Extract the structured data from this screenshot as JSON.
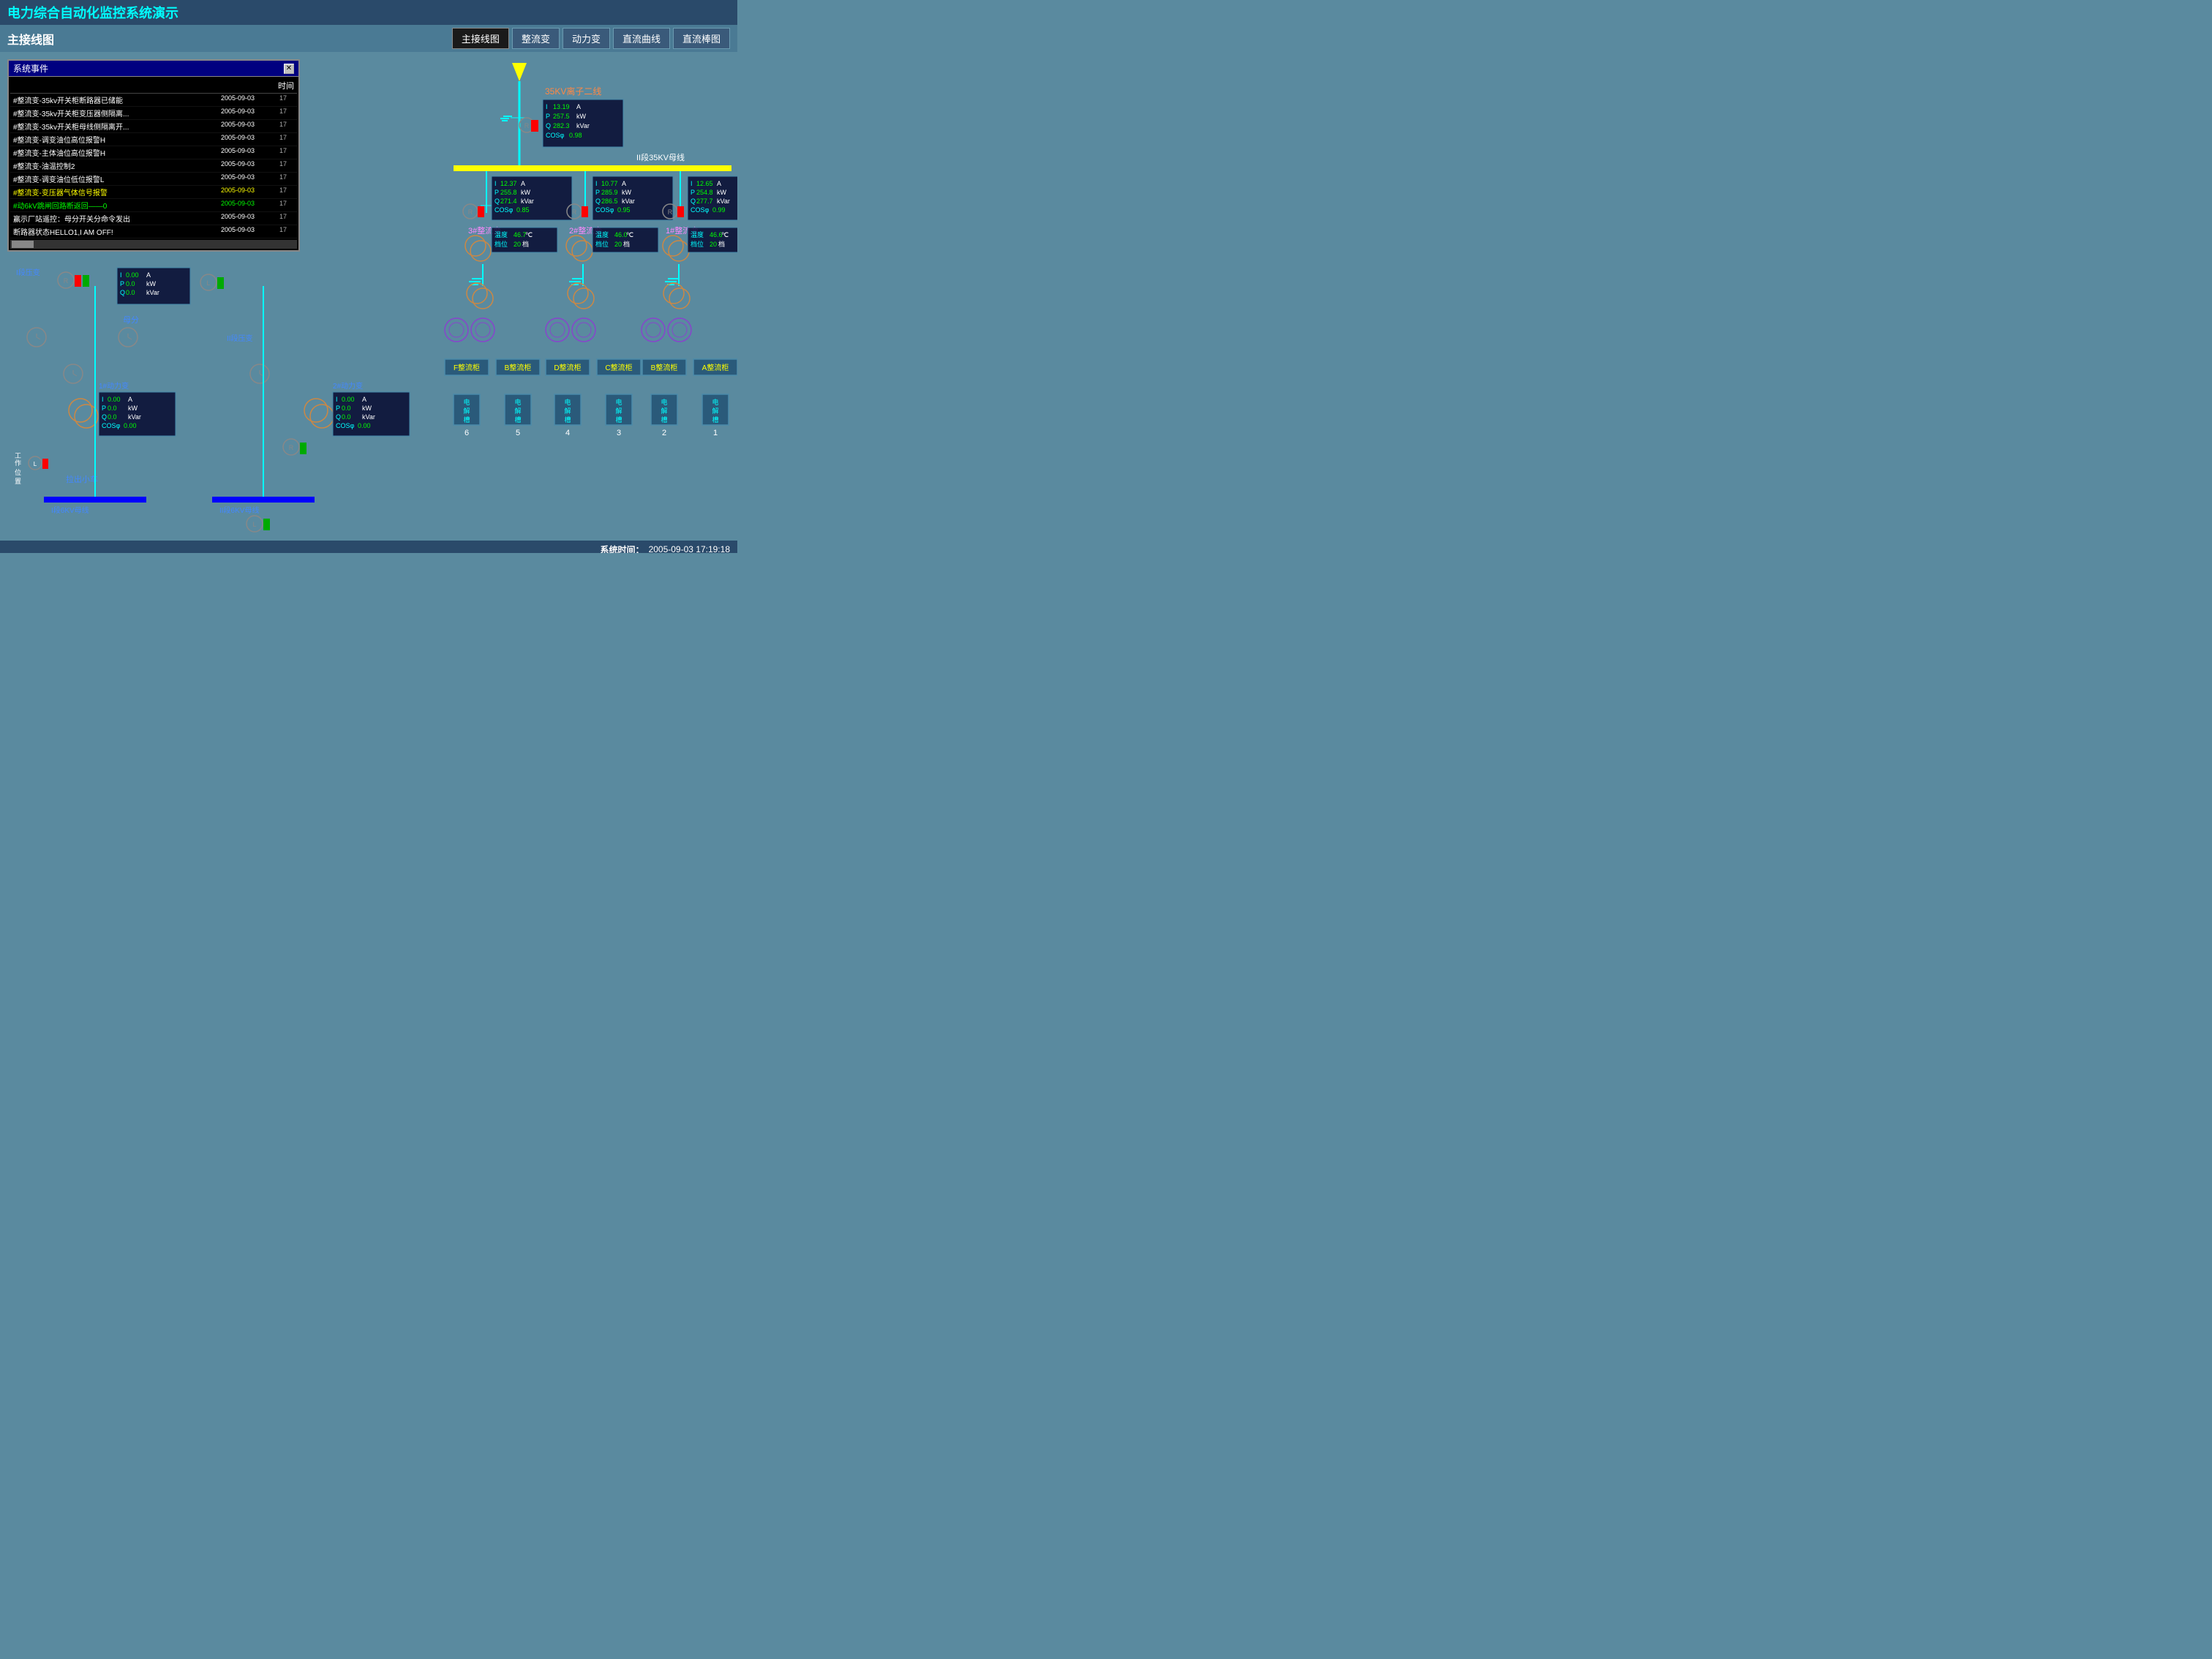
{
  "title": "电力综合自动化监控系统演示",
  "subtitle": "主接线图",
  "nav": {
    "buttons": [
      {
        "label": "主接线图",
        "active": true
      },
      {
        "label": "整流变",
        "active": false
      },
      {
        "label": "动力变",
        "active": false
      },
      {
        "label": "直流曲线",
        "active": false
      },
      {
        "label": "直流棒图",
        "active": false
      }
    ]
  },
  "dialog": {
    "title": "系统事件",
    "time_header": "时间",
    "events": [
      {
        "msg": "#整流变-35kv开关柜断路器已储能",
        "date": "2005-09-03",
        "time": "17",
        "color": "white"
      },
      {
        "msg": "#整流变-35kv开关柜变压器侧隔离...",
        "date": "2005-09-03",
        "time": "17",
        "color": "white"
      },
      {
        "msg": "#整流变-35kv开关柜母线侧隔离开...",
        "date": "2005-09-03",
        "time": "17",
        "color": "white"
      },
      {
        "msg": "#整流变-调变油位高位报警H",
        "date": "2005-09-03",
        "time": "17",
        "color": "white"
      },
      {
        "msg": "#整流变-主体油位高位报警H",
        "date": "2005-09-03",
        "time": "17",
        "color": "white"
      },
      {
        "msg": "#整流变-油温控制2",
        "date": "2005-09-03",
        "time": "17",
        "color": "white"
      },
      {
        "msg": "#整流变-调变油位低位报警L",
        "date": "2005-09-03",
        "time": "17",
        "color": "white"
      },
      {
        "msg": "#整流变-变压器气体信号报警",
        "date": "2005-09-03",
        "time": "17",
        "color": "yellow"
      },
      {
        "msg": "#动6kV跳闸回路断返回——0",
        "date": "2005-09-03",
        "time": "17",
        "color": "green"
      },
      {
        "msg": "赢示厂站遥控：母分开关分命令发出",
        "date": "2005-09-03",
        "time": "17",
        "color": "white"
      },
      {
        "msg": "断路器状态HELLO1,I AM OFF!",
        "date": "2005-09-03",
        "time": "17",
        "color": "white"
      }
    ]
  },
  "section_35kv": {
    "title": "35KV离子二线",
    "busbar_label": "II段35KV母线",
    "measurements": {
      "I": "13.19",
      "I_unit": "A",
      "P": "257.5",
      "P_unit": "kW",
      "Q": "282.3",
      "Q_unit": "kVar",
      "COS": "0.98"
    }
  },
  "rectifiers": [
    {
      "name": "3#整流变",
      "I": "12.37",
      "I_unit": "A",
      "P": "255.8",
      "P_unit": "kW",
      "Q": "271.4",
      "Q_unit": "kVar",
      "COS": "0.85",
      "temp": "46.7",
      "temp_unit": "℃",
      "档位": "20",
      "档": "档"
    },
    {
      "name": "2#整流变",
      "I": "10.77",
      "I_unit": "A",
      "P": "285.9",
      "P_unit": "kW",
      "Q": "286.5",
      "Q_unit": "kVar",
      "COS": "0.95",
      "temp": "46.0",
      "temp_unit": "℃",
      "档位": "20",
      "档": "档"
    },
    {
      "name": "1#整流变",
      "I": "12.65",
      "I_unit": "A",
      "P": "254.8",
      "P_unit": "kW",
      "Q": "277.7",
      "Q_unit": "kVar",
      "COS": "0.99",
      "temp": "46.6",
      "temp_unit": "℃",
      "档位": "20",
      "档": "档"
    }
  ],
  "left_section": {
    "transformer1": "I段压变",
    "transformer2": "II段压变",
    "busbar1": "I段6KV母线",
    "busbar2": "II段6KV母线",
    "busbar_main": "母分",
    "pull_out": "拉出小车",
    "dynamic1": "1#动力变",
    "dynamic2": "2#动力变",
    "measurements1": {
      "I": "0.00",
      "I_unit": "A",
      "P": "0.0",
      "P_unit": "kW",
      "Q": "0.0",
      "Q_unit": "kVar"
    },
    "measurements2": {
      "I": "0.00",
      "I_unit": "A",
      "P": "0.0",
      "P_unit": "kW",
      "Q": "0.0",
      "Q_unit": "kVar",
      "COS": "0.00"
    },
    "measurements3": {
      "I": "0.00",
      "I_unit": "A",
      "P": "0.0",
      "P_unit": "kW",
      "Q": "0.0",
      "Q_unit": "kVar",
      "COS": "0.00"
    },
    "pos_label": "工作位置"
  },
  "cabinets": [
    {
      "name": "F整流柜",
      "tank": "电解槽",
      "num": "6"
    },
    {
      "name": "B整流柜",
      "tank": "电解槽",
      "num": "5"
    },
    {
      "name": "D整流柜",
      "tank": "电解槽",
      "num": "4"
    },
    {
      "name": "C整流柜",
      "tank": "电解槽",
      "num": "3"
    },
    {
      "name": "B整流柜",
      "tank": "电解槽",
      "num": "2"
    },
    {
      "name": "A整流柜",
      "tank": "电解槽",
      "num": "1"
    }
  ],
  "status_bar": {
    "label": "系统时间：",
    "datetime": "2005-09-03  17:19:18"
  },
  "cos_label": "COS Φ"
}
